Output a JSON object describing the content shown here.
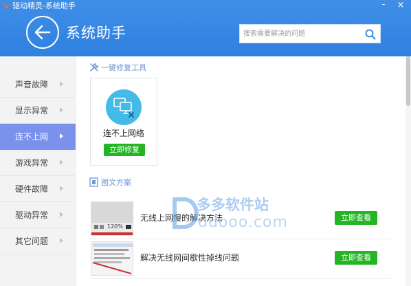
{
  "titlebar": {
    "title": "驱动精灵-系统助手",
    "minimize": "-",
    "close": "×"
  },
  "header": {
    "page_title": "系统助手"
  },
  "search": {
    "placeholder": "搜索需要解决的问题"
  },
  "sidebar": {
    "items": [
      {
        "label": "声音故障",
        "active": false
      },
      {
        "label": "显示异常",
        "active": false
      },
      {
        "label": "连不上网",
        "active": true
      },
      {
        "label": "游戏异常",
        "active": false
      },
      {
        "label": "硬件故障",
        "active": false
      },
      {
        "label": "驱动异常",
        "active": false
      },
      {
        "label": "其它问题",
        "active": false
      }
    ]
  },
  "tools": {
    "heading": "一键修复工具",
    "card": {
      "name": "连不上网络",
      "button": "立即修复"
    }
  },
  "articles": {
    "heading": "图文方案",
    "items": [
      {
        "title": "无线上网慢的解决方法",
        "button": "立即查看",
        "thumb_text": "120%"
      },
      {
        "title": "解决无线网间歇性掉线问题",
        "button": "立即查看"
      }
    ]
  },
  "watermark": {
    "cn": "多多软件站",
    "url": "ddooo.com"
  },
  "colors": {
    "header_blue": "#3388e6",
    "active_item": "#7b92ec",
    "green_button": "#24b524",
    "tool_icon_bg": "#44bbe6"
  }
}
